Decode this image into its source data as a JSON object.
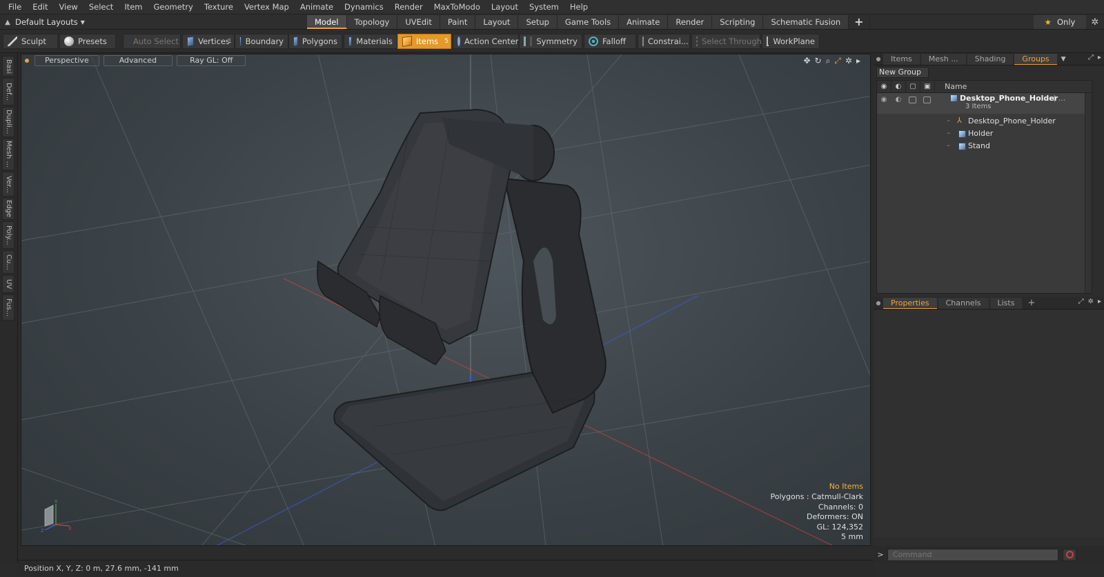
{
  "menu": [
    "File",
    "Edit",
    "View",
    "Select",
    "Item",
    "Geometry",
    "Texture",
    "Vertex Map",
    "Animate",
    "Dynamics",
    "Render",
    "MaxToModo",
    "Layout",
    "System",
    "Help"
  ],
  "layouts": {
    "label": "Default Layouts"
  },
  "mode_tabs": [
    "Model",
    "Topology",
    "UVEdit",
    "Paint",
    "Layout",
    "Setup",
    "Game Tools",
    "Animate",
    "Render",
    "Scripting",
    "Schematic Fusion"
  ],
  "mode_tabs_plus": "+",
  "only_label": "Only",
  "toolbar": {
    "sculpt": "Sculpt",
    "presets": "Presets",
    "auto_select": "Auto Select",
    "vertices": "Vertices",
    "vertices_count": "1",
    "boundary": "Boundary",
    "polygons": "Polygons",
    "materials": "Materials",
    "items": "Items",
    "items_count": "5",
    "action_center": "Action Center",
    "symmetry": "Symmetry",
    "falloff": "Falloff",
    "constraints": "Constrai...",
    "select_through": "Select Through",
    "workplane": "WorkPlane"
  },
  "left_tabs": [
    "Basi",
    "Def...",
    "Dupli...",
    "Mesh ...",
    "Ver...",
    "Edge",
    "Poly...",
    "Cu...",
    "UV",
    "Fus..."
  ],
  "viewport": {
    "view": "Perspective",
    "shading": "Advanced",
    "raygl": "Ray GL: Off",
    "info": {
      "no_items": "No Items",
      "polygons": "Polygons : Catmull-Clark",
      "channels": "Channels: 0",
      "deformers": "Deformers: ON",
      "gl": "GL: 124,352",
      "scale": "5 mm"
    },
    "axis_x": "X",
    "axis_y": "Y",
    "axis_z": "Z"
  },
  "panel_top": {
    "tabs": [
      "Items",
      "Mesh ...",
      "Shading",
      "Groups"
    ],
    "active": "Groups",
    "new_group": "New Group",
    "col_name": "Name",
    "group_name": "Desktop_Phone_Holder",
    "group_suffix": "( ...",
    "group_count": "3 Items",
    "children": [
      "Desktop_Phone_Holder",
      "Holder",
      "Stand"
    ]
  },
  "panel_bottom": {
    "tabs": [
      "Properties",
      "Channels",
      "Lists"
    ],
    "active": "Properties",
    "plus": "+"
  },
  "command": {
    "placeholder": "Command",
    "arrow": ">"
  },
  "status": {
    "position": "Position X, Y, Z:  0 m, 27.6 mm, -141 mm"
  },
  "colors": {
    "accent": "#e8a33c",
    "active_tab_text": "#f0a53a",
    "viewport_bg": "#3b4247"
  }
}
